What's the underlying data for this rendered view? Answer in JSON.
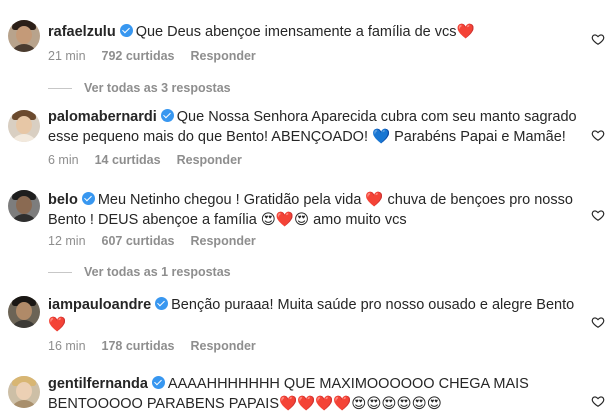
{
  "comments": [
    {
      "username": "rafaelzulu",
      "text": "Que Deus abençoe imensamente a família de vcs❤️",
      "time": "21 min",
      "likes": "792 curtidas",
      "reply": "Responder",
      "view_replies": "Ver todas as 3 respostas"
    },
    {
      "username": "palomabernardi",
      "text": "Que Nossa Senhora Aparecida cubra com seu manto sagrado esse pequeno mais do que Bento! ABENÇOADO! 💙 Parabéns Papai e Mamãe!",
      "time": "6 min",
      "likes": "14 curtidas",
      "reply": "Responder"
    },
    {
      "username": "belo",
      "text": "Meu Netinho chegou ! Gratidão pela vida ❤️ chuva de bençoes pro nosso Bento ! DEUS abençoe a família 😍❤️😍 amo muito vcs",
      "time": "12 min",
      "likes": "607 curtidas",
      "reply": "Responder",
      "view_replies": "Ver todas as 1 respostas"
    },
    {
      "username": "iampauloandre",
      "text": "Benção puraaa! Muita saúde pro nosso ousado e alegre Bento ❤️",
      "time": "16 min",
      "likes": "178 curtidas",
      "reply": "Responder"
    },
    {
      "username": "gentilfernanda",
      "text": "AAAAHHHHHHH QUE MAXIMOOOOOO CHEGA MAIS BENTOOOOO PARABENS PAPAIS❤️❤️❤️❤️😍😍😍😍😍😍",
      "time": "",
      "likes": "",
      "reply": ""
    }
  ],
  "icons": {
    "verified": "verified-badge-icon",
    "like": "heart-outline-icon"
  },
  "colors": {
    "verified_blue": "#3897f0",
    "meta_gray": "#8e8e8e",
    "text": "#262626"
  }
}
